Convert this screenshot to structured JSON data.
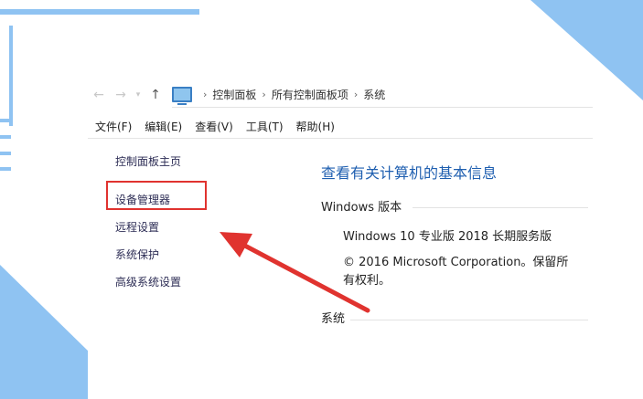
{
  "address_bar": {
    "crumbs": [
      "控制面板",
      "所有控制面板项",
      "系统"
    ]
  },
  "menu": {
    "file": "文件(F)",
    "edit": "编辑(E)",
    "view": "查看(V)",
    "tools": "工具(T)",
    "help": "帮助(H)"
  },
  "sidebar": {
    "home": "控制面板主页",
    "items": [
      "设备管理器",
      "远程设置",
      "系统保护",
      "高级系统设置"
    ]
  },
  "main": {
    "title": "查看有关计算机的基本信息",
    "windows_edition_label": "Windows 版本",
    "edition": "Windows 10 专业版 2018 长期服务版",
    "copyright_line1": "© 2016 Microsoft Corporation。保留所",
    "copyright_line2": "有权利。",
    "system_label": "系统"
  },
  "colors": {
    "accent_blue": "#1f5fb0",
    "highlight_red": "#e0332f",
    "deco_blue": "#8fc3f2"
  }
}
